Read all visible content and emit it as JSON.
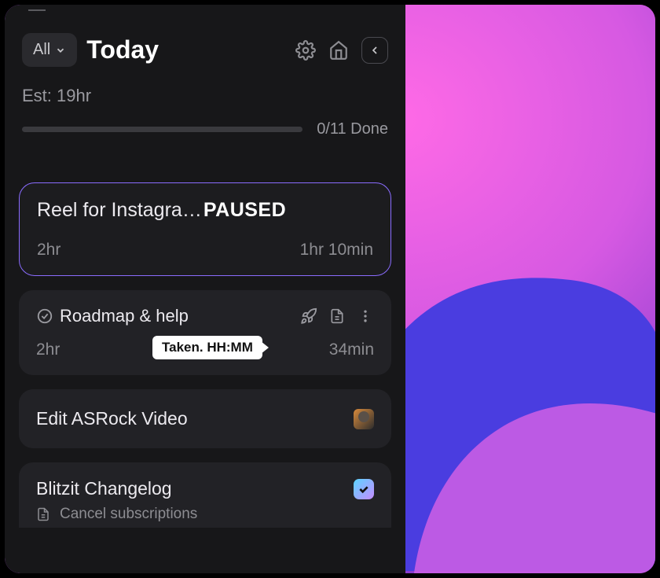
{
  "header": {
    "filter_label": "All",
    "title": "Today"
  },
  "stats": {
    "estimate_label": "Est: 19hr",
    "done_label": "0/11 Done"
  },
  "tasks": [
    {
      "title": "Reel for Instagra…",
      "state": "PAUSED",
      "estimate": "2hr",
      "elapsed": "1hr 10min"
    },
    {
      "title": "Roadmap & help",
      "estimate": "2hr",
      "elapsed": "34min",
      "tooltip": "Taken. HH:MM"
    },
    {
      "title": "Edit ASRock Video"
    },
    {
      "title": "Blitzit Changelog",
      "subtask": "Cancel subscriptions"
    }
  ]
}
